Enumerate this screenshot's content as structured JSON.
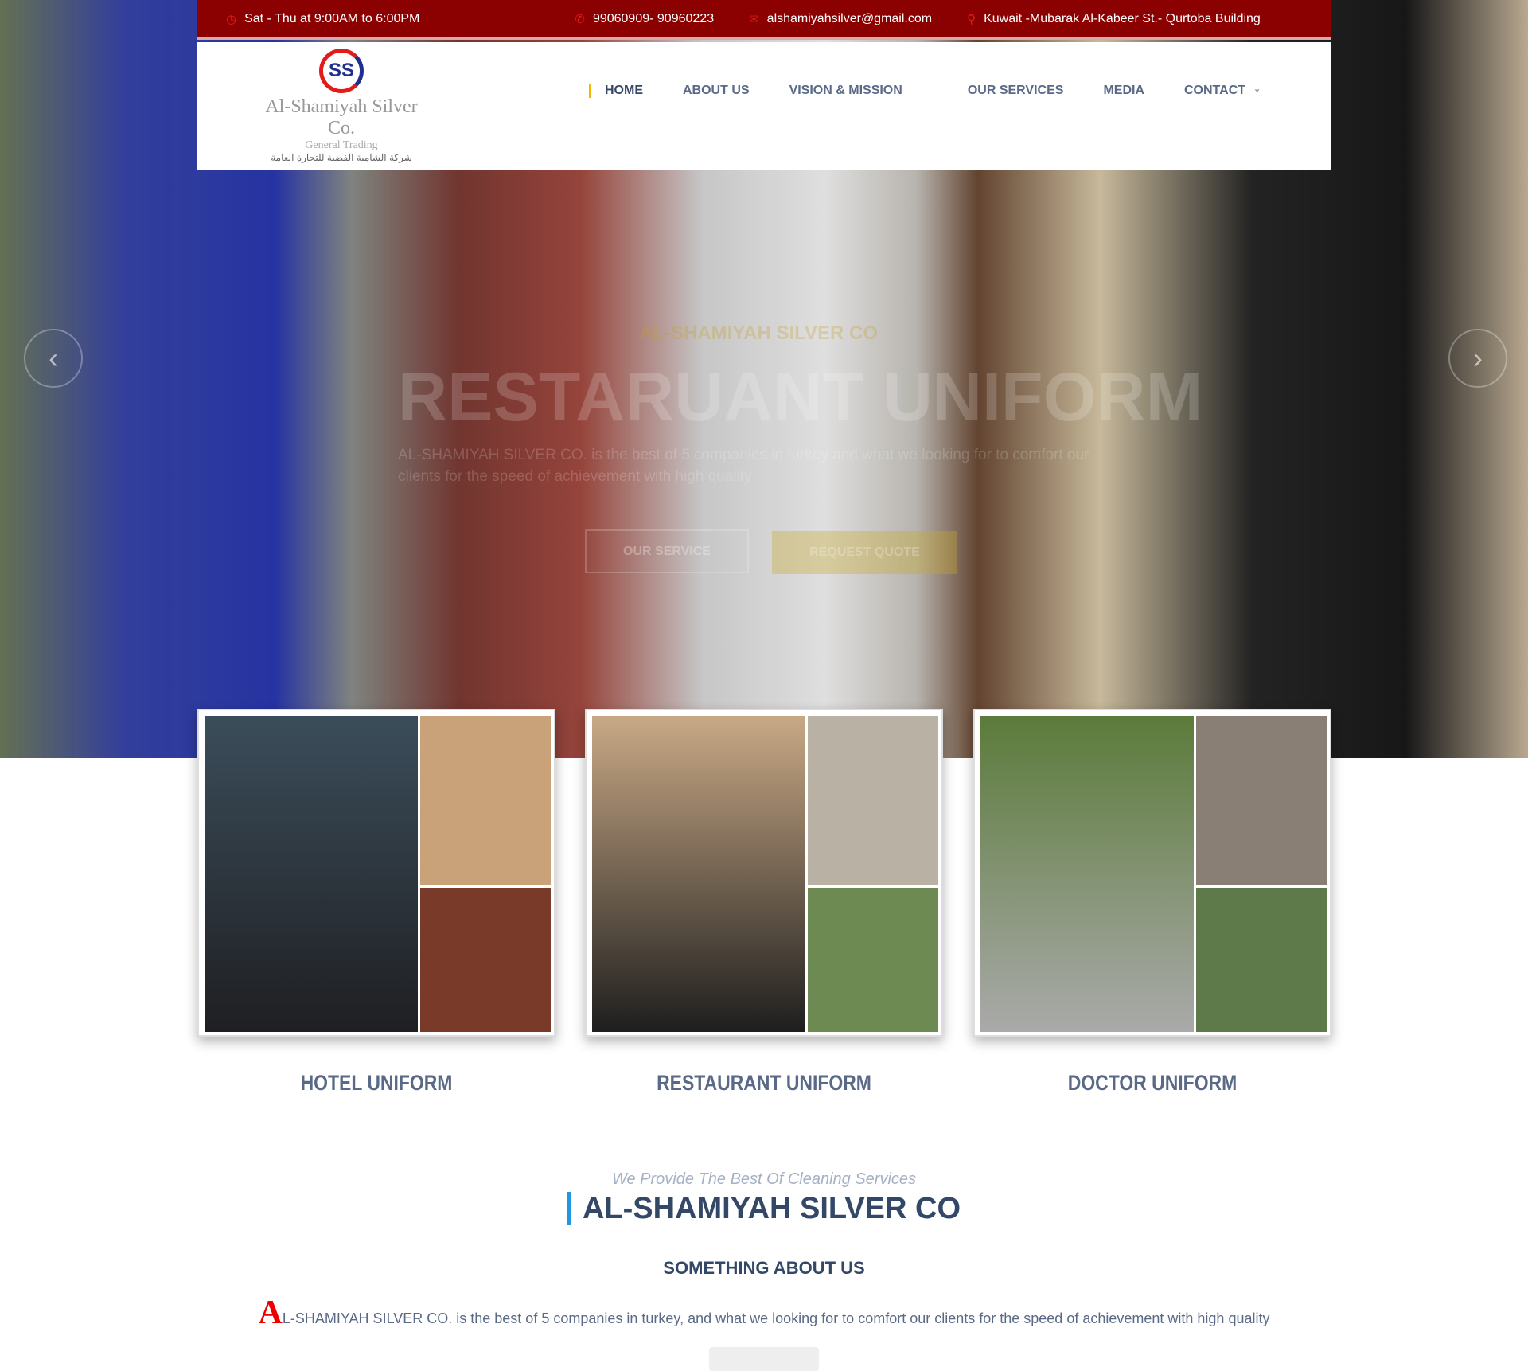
{
  "topbar": {
    "hours": "Sat - Thu at 9:00AM to 6:00PM",
    "phone": "99060909- 90960223",
    "email": "alshamiyahsilver@gmail.com",
    "address": "Kuwait -Mubarak Al-Kabeer St.- Qurtoba Building"
  },
  "logo": {
    "name": "Al-Shamiyah Silver Co.",
    "sub": "General Trading",
    "arabic": "شركة الشامية الفضية للتجارة العامة"
  },
  "nav": [
    "HOME",
    "ABOUT US",
    "VISION & MISSION",
    "OUR SERVICES",
    "MEDIA",
    "CONTACT"
  ],
  "hero": {
    "kicker": "AL-SHAMIYAH SILVER CO",
    "title": "RESTARUANT UNIFORM",
    "text": "AL-SHAMIYAH SILVER CO. is the best of 5 companies in turkey and what we looking for to comfort our clients for the speed of achievement with high quality",
    "btn1": "OUR SERVICE",
    "btn2": "REQUEST QUOTE"
  },
  "cards": [
    {
      "title": "HOTEL UNIFORM"
    },
    {
      "title": "RESTAURANT UNIFORM"
    },
    {
      "title": "DOCTOR UNIFORM"
    }
  ],
  "about": {
    "tagline": "We Provide The Best Of Cleaning Services",
    "heading": "AL-SHAMIYAH SILVER CO",
    "subheading": "SOMETHING ABOUT US",
    "drop": "A",
    "text": "L-SHAMIYAH SILVER CO. is the best of 5 companies in turkey, and what we looking for to comfort our clients for the speed of achievement with high quality"
  },
  "colors": {
    "topbar": "#8b0000",
    "accent": "#f2b600",
    "heading": "#334766",
    "dropcap": "#e00000"
  }
}
